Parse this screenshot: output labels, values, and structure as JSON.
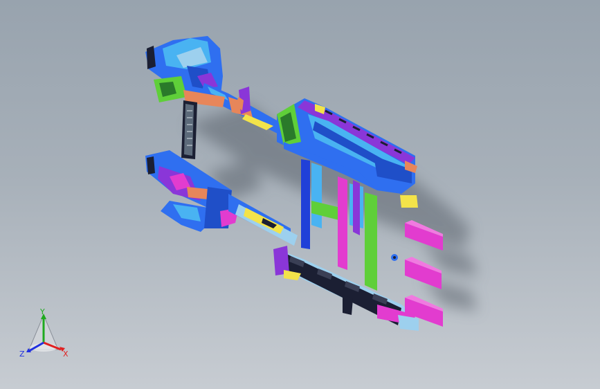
{
  "viewport": {
    "background_top": "#98a3ae",
    "background_bottom": "#c7ccd2"
  },
  "model": {
    "description_icon": "vehicle-body-frame-assembly",
    "colors": {
      "blue": "#2f6ff0",
      "cyan": "#49b3f2",
      "magenta": "#e23ccf",
      "yellow": "#f3e34a",
      "green": "#5fcf39",
      "orange": "#e7865a",
      "purple": "#8a36d8",
      "dark": "#1b1f33",
      "light_blue": "#9dd0ee",
      "shadow": "#5c646d"
    }
  },
  "triad": {
    "y_label": "Y",
    "x_label": "X",
    "z_label": "Z",
    "y_color": "#1faa1f",
    "x_color": "#e02020",
    "z_color": "#2030e0"
  }
}
